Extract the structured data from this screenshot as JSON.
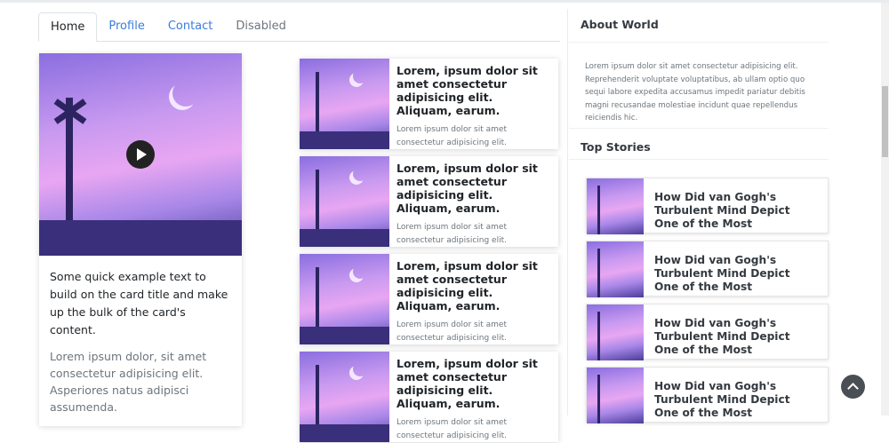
{
  "tabs": [
    {
      "label": "Home"
    },
    {
      "label": "Profile"
    },
    {
      "label": "Contact"
    },
    {
      "label": "Disabled"
    }
  ],
  "feature_card": {
    "text": "Some quick example text to build on the card title and make up the bulk of the card's content.",
    "subtext": "Lorem ipsum dolor, sit amet consectetur adipisicing elit. Asperiores natus adipisci assumenda."
  },
  "posts": [
    {
      "title": "Lorem, ipsum dolor sit amet consectetur adipisicing elit. Aliquam, earum.",
      "text": "Lorem ipsum dolor sit amet consectetur adipisicing elit."
    },
    {
      "title": "Lorem, ipsum dolor sit amet consectetur adipisicing elit. Aliquam, earum.",
      "text": "Lorem ipsum dolor sit amet consectetur adipisicing elit."
    },
    {
      "title": "Lorem, ipsum dolor sit amet consectetur adipisicing elit. Aliquam, earum.",
      "text": "Lorem ipsum dolor sit amet consectetur adipisicing elit."
    },
    {
      "title": "Lorem, ipsum dolor sit amet consectetur adipisicing elit. Aliquam, earum.",
      "text": "Lorem ipsum dolor sit amet consectetur adipisicing elit."
    }
  ],
  "sidebar": {
    "about_title": "About World",
    "about_text": "Lorem ipsum dolor sit amet consectetur adipisicing elit. Reprehenderit voluptate voluptatibus, ab ullam optio quo sequi labore expedita accusamus impedit pariatur debitis magni recusandae molestiae incidunt quae repellendus reiciendis hic.",
    "stories_title": "Top Stories",
    "stories": [
      {
        "title": "How Did van Gogh's Turbulent Mind Depict One of the Most"
      },
      {
        "title": "How Did van Gogh's Turbulent Mind Depict One of the Most"
      },
      {
        "title": "How Did van Gogh's Turbulent Mind Depict One of the Most"
      },
      {
        "title": "How Did van Gogh's Turbulent Mind Depict One of the Most"
      }
    ]
  }
}
